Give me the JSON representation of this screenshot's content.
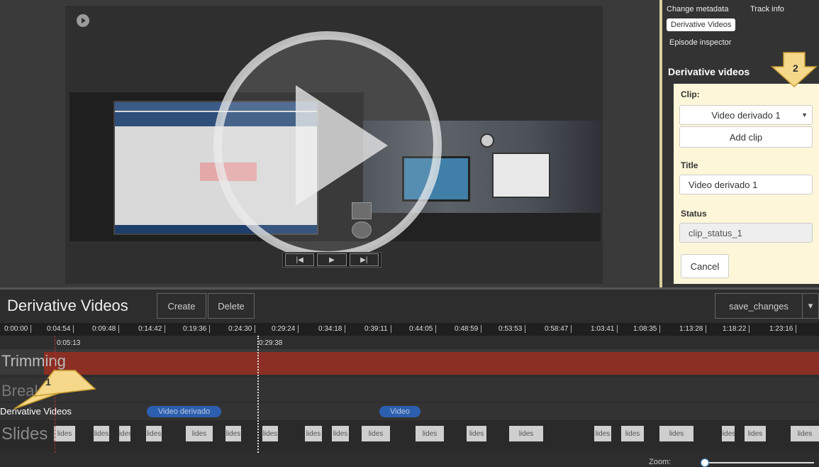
{
  "panel": {
    "tabs": {
      "change_metadata": "Change metadata",
      "track_info": "Track info",
      "derivative_videos": "Derivative Videos",
      "episode_inspector": "Episode inspector"
    },
    "heading": "Derivative videos",
    "clip_label": "Clip:",
    "clip_selected": "Video derivado 1",
    "add_clip": "Add clip",
    "title_label": "Title",
    "title_value": "Video derivado 1",
    "status_label": "Status",
    "status_value": "clip_status_1",
    "cancel": "Cancel"
  },
  "markers": {
    "one": "1",
    "two": "2"
  },
  "timeline": {
    "title": "Derivative Videos",
    "create": "Create",
    "delete": "Delete",
    "save": "save_changes",
    "save_caret": "▾",
    "ticks": [
      "0:00:00",
      "0:04:54",
      "0:09:48",
      "0:14:42",
      "0:19:36",
      "0:24:30",
      "0:29:24",
      "0:34:18",
      "0:39:11",
      "0:44:05",
      "0:48:59",
      "0:53:53",
      "0:58:47",
      "1:03:41",
      "1:08:35",
      "1:13:28",
      "1:18:22",
      "1:23:16"
    ],
    "in_time": "0:05:13",
    "out_time": "0:29:38",
    "tracks": {
      "trimming": "Trimming",
      "breaks": "Breaks",
      "derivative": "Derivative Videos",
      "slides": "Slides"
    },
    "clips": [
      "Video derivado",
      "Video"
    ],
    "slide_label": "lides",
    "zoom_label": "Zoom:",
    "zoom_level": 0.02
  },
  "player": {
    "controls": {
      "prev": "|◀",
      "play": "▶",
      "next": "▶|"
    }
  },
  "colors": {
    "trim": "#8b2e24",
    "clip": "#2c5fb0",
    "form_bg": "#fdf6d9",
    "marker": "#f5d88a"
  }
}
